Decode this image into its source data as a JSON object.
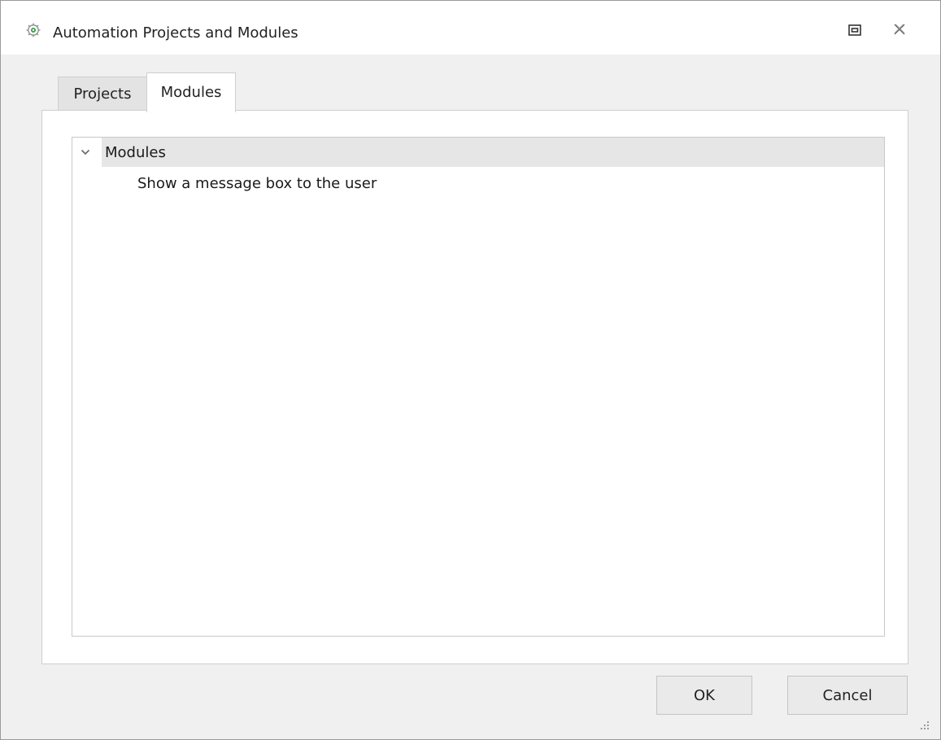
{
  "window": {
    "title": "Automation Projects and Modules",
    "icon": "gear-icon"
  },
  "titlebar_buttons": {
    "restore_icon": "restore-icon",
    "close_icon": "close-icon"
  },
  "tabs": [
    {
      "label": "Projects",
      "selected": false
    },
    {
      "label": "Modules",
      "selected": true
    }
  ],
  "tree": {
    "root": {
      "label": "Modules",
      "expanded": true,
      "icon": "chevron-down-icon"
    },
    "children": [
      {
        "label": "Show a message box to the user"
      }
    ]
  },
  "buttons": {
    "ok_label": "OK",
    "cancel_label": "Cancel"
  },
  "colors": {
    "content_background": "#f0f0f0",
    "tree_root_highlight": "#e6e6e6",
    "icon_green": "#3aa047"
  }
}
